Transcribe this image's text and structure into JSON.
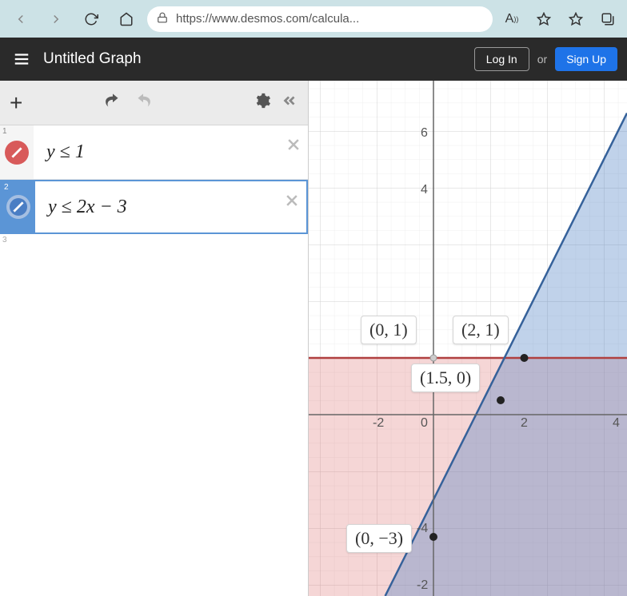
{
  "browser": {
    "url": "https://www.desmos.com/calcula..."
  },
  "header": {
    "title": "Untitled Graph",
    "login": "Log In",
    "or": "or",
    "signup": "Sign Up"
  },
  "expressions": {
    "rows": [
      {
        "index": "1",
        "formula": "y ≤ 1",
        "color": "red"
      },
      {
        "index": "2",
        "formula": "y ≤ 2x − 3",
        "color": "blue"
      }
    ],
    "ghost_index": "3"
  },
  "graph": {
    "points": [
      {
        "label": "(0, 1)",
        "x": 0,
        "y": 1
      },
      {
        "label": "(2, 1)",
        "x": 2,
        "y": 1
      },
      {
        "label": "(1.5, 0)",
        "x": 1.5,
        "y": 0
      },
      {
        "label": "(0, −3)",
        "x": 0,
        "y": -3
      }
    ],
    "axis_ticks_x": [
      {
        "v": -2,
        "t": "-2"
      },
      {
        "v": 0,
        "t": "0"
      },
      {
        "v": 2,
        "t": "2"
      },
      {
        "v": 4,
        "t": "4"
      }
    ],
    "axis_ticks_y": [
      {
        "v": -4,
        "t": "-4"
      },
      {
        "v": -2,
        "t": "-2"
      },
      {
        "v": 4,
        "t": "4"
      },
      {
        "v": 6,
        "t": "6"
      }
    ]
  },
  "chart_data": {
    "type": "region",
    "inequalities": [
      {
        "expr": "y <= 1",
        "line": {
          "slope": 0,
          "intercept": 1
        },
        "color": "#d85a5a"
      },
      {
        "expr": "y <= 2x - 3",
        "line": {
          "slope": 2,
          "intercept": -3
        },
        "color": "#4a7ec4"
      }
    ],
    "marked_points": [
      {
        "x": 0,
        "y": 1
      },
      {
        "x": 2,
        "y": 1
      },
      {
        "x": 1.5,
        "y": 0
      },
      {
        "x": 0,
        "y": -3
      }
    ],
    "xrange": [
      -3,
      5
    ],
    "yrange": [
      -5,
      7
    ],
    "xlabel": "",
    "ylabel": "",
    "title": ""
  }
}
